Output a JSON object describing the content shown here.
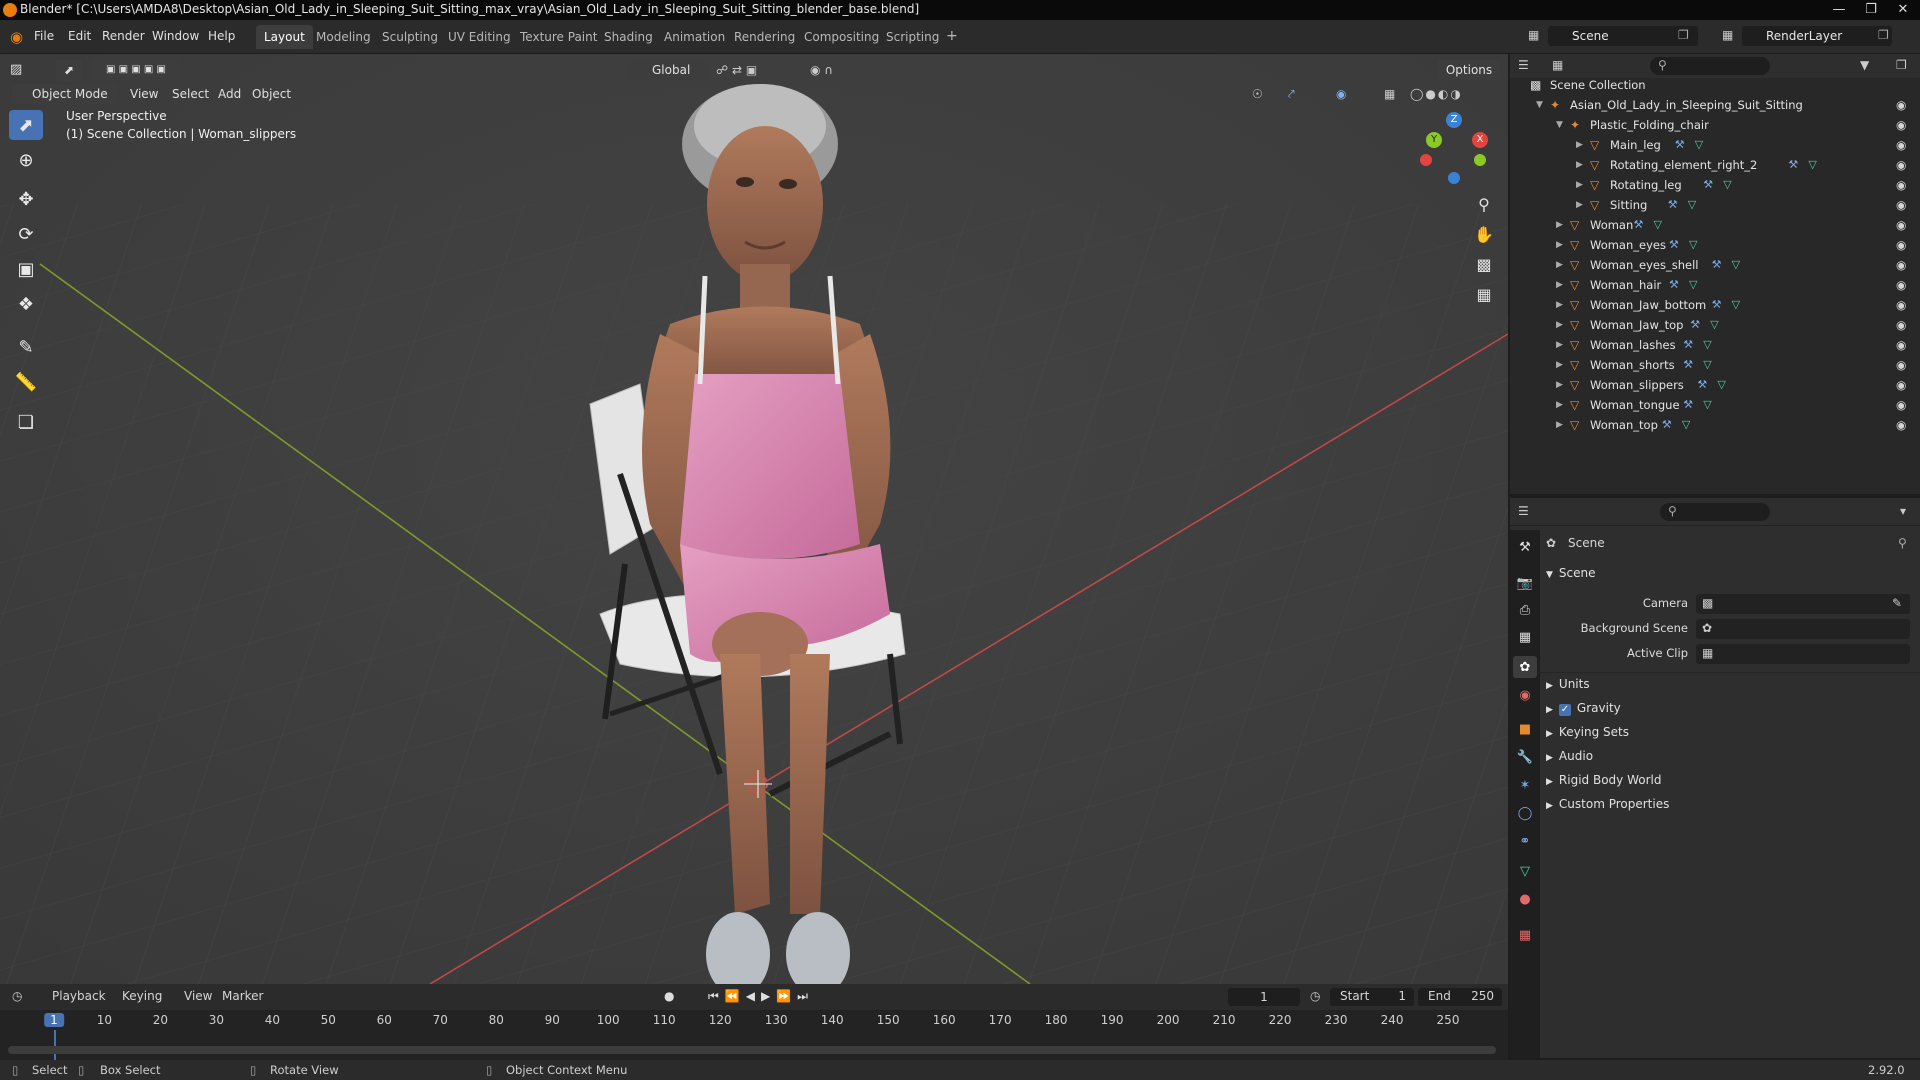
{
  "window": {
    "title": "Blender* [C:\\Users\\AMDA8\\Desktop\\Asian_Old_Lady_in_Sleeping_Suit_Sitting_max_vray\\Asian_Old_Lady_in_Sleeping_Suit_Sitting_blender_base.blend]"
  },
  "menu": [
    "File",
    "Edit",
    "Render",
    "Window",
    "Help"
  ],
  "workspaces": [
    "Layout",
    "Modeling",
    "Sculpting",
    "UV Editing",
    "Texture Paint",
    "Shading",
    "Animation",
    "Rendering",
    "Compositing",
    "Scripting"
  ],
  "active_workspace": "Layout",
  "scene_selector": "Scene",
  "view_layer": "RenderLayer",
  "viewport_header": {
    "mode": "Object Mode",
    "menus": [
      "View",
      "Select",
      "Add",
      "Object"
    ],
    "transform_orientation": "Global",
    "options": "Options"
  },
  "viewport": {
    "perspective": "User Perspective",
    "collection_info": "(1) Scene Collection | Woman_slippers",
    "gizmo": {
      "z": "Z",
      "y": "Y",
      "x": "X"
    }
  },
  "outliner": {
    "root": "Scene Collection",
    "collection": "Asian_Old_Lady_in_Sleeping_Suit_Sitting",
    "chair": "Plastic_Folding_chair",
    "chair_children": [
      "Main_leg",
      "Rotating_element_right_2",
      "Rotating_leg",
      "Sitting"
    ],
    "objects": [
      "Woman",
      "Woman_eyes",
      "Woman_eyes_shell",
      "Woman_hair",
      "Woman_Jaw_bottom",
      "Woman_Jaw_top",
      "Woman_lashes",
      "Woman_shorts",
      "Woman_slippers",
      "Woman_tongue",
      "Woman_top"
    ]
  },
  "properties": {
    "context": "Scene",
    "panel_title": "Scene",
    "camera_label": "Camera",
    "background_scene_label": "Background Scene",
    "active_clip_label": "Active Clip",
    "panels": [
      "Units",
      "Gravity",
      "Keying Sets",
      "Audio",
      "Rigid Body World",
      "Custom Properties"
    ]
  },
  "timeline": {
    "menus": [
      "Playback",
      "Keying",
      "View",
      "Marker"
    ],
    "current_frame": "1",
    "start_label": "Start",
    "start": "1",
    "end_label": "End",
    "end": "250",
    "ticks": [
      "1",
      "10",
      "20",
      "30",
      "40",
      "50",
      "60",
      "70",
      "80",
      "90",
      "100",
      "110",
      "120",
      "130",
      "140",
      "150",
      "160",
      "170",
      "180",
      "190",
      "200",
      "210",
      "220",
      "230",
      "240",
      "250"
    ]
  },
  "statusbar": {
    "select": "Select",
    "box_select": "Box Select",
    "rotate_view": "Rotate View",
    "context_menu": "Object Context Menu",
    "version": "2.92.0"
  },
  "colors": {
    "accent": "#4772b3",
    "object_orange": "#e58b2b",
    "x_axis": "#e2443f",
    "y_axis": "#8ac926",
    "z_axis": "#3b82d6"
  }
}
